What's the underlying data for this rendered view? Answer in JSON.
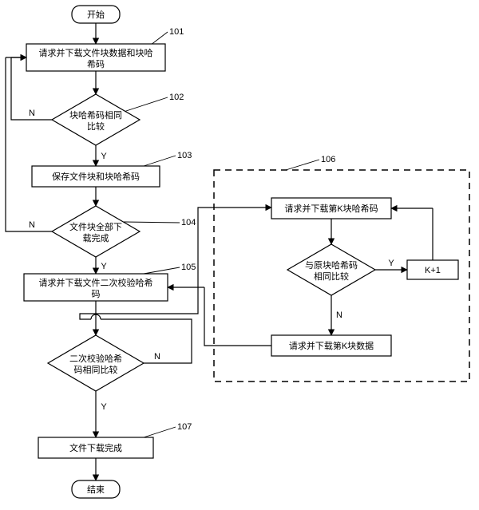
{
  "chart_data": {
    "type": "flowchart",
    "title": "",
    "nodes": [
      {
        "id": "start",
        "kind": "terminator",
        "label": "开始"
      },
      {
        "id": "n101",
        "kind": "process",
        "label": "请求并下载文件块数据和块哈希码",
        "ref": "101"
      },
      {
        "id": "n102",
        "kind": "decision",
        "label": "块哈希码相同比较",
        "ref": "102"
      },
      {
        "id": "n103",
        "kind": "process",
        "label": "保存文件块和块哈希码",
        "ref": "103"
      },
      {
        "id": "n104",
        "kind": "decision",
        "label": "文件块全部下载完成",
        "ref": "104"
      },
      {
        "id": "n105",
        "kind": "process",
        "label": "请求并下载文件二次校验哈希码",
        "ref": "105"
      },
      {
        "id": "n105d",
        "kind": "decision",
        "label": "二次校验哈希码相同比较"
      },
      {
        "id": "n107",
        "kind": "process",
        "label": "文件下载完成",
        "ref": "107"
      },
      {
        "id": "end",
        "kind": "terminator",
        "label": "结束"
      },
      {
        "id": "grp106",
        "kind": "group",
        "label": "",
        "ref": "106"
      },
      {
        "id": "g1",
        "kind": "process",
        "label": "请求并下载第K块哈希码"
      },
      {
        "id": "g2",
        "kind": "decision",
        "label": "与原块哈希码相同比较"
      },
      {
        "id": "g3",
        "kind": "process",
        "label": "请求并下载第K块数据"
      },
      {
        "id": "kinc",
        "kind": "process",
        "label": "K+1"
      }
    ],
    "edges": [
      {
        "from": "start",
        "to": "n101"
      },
      {
        "from": "n101",
        "to": "n102"
      },
      {
        "from": "n102",
        "to": "n103",
        "label": "Y"
      },
      {
        "from": "n102",
        "to": "n101",
        "label": "N"
      },
      {
        "from": "n103",
        "to": "n104"
      },
      {
        "from": "n104",
        "to": "n105",
        "label": "Y"
      },
      {
        "from": "n104",
        "to": "n101",
        "label": "N"
      },
      {
        "from": "n105",
        "to": "n105d"
      },
      {
        "from": "n105d",
        "to": "n107",
        "label": "Y"
      },
      {
        "from": "n105d",
        "to": "g1",
        "label": "N"
      },
      {
        "from": "n107",
        "to": "end"
      },
      {
        "from": "g1",
        "to": "g2"
      },
      {
        "from": "g2",
        "to": "kinc",
        "label": "Y"
      },
      {
        "from": "g2",
        "to": "g3",
        "label": "N"
      },
      {
        "from": "kinc",
        "to": "g1"
      },
      {
        "from": "g3",
        "to": "n105"
      }
    ]
  },
  "labels": {
    "y": "Y",
    "n": "N"
  }
}
